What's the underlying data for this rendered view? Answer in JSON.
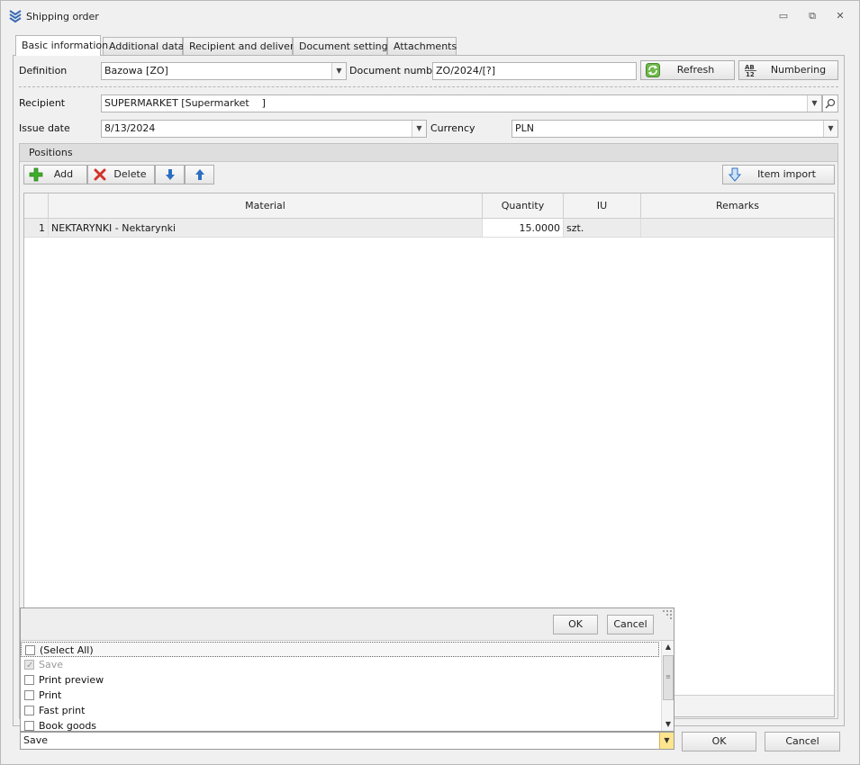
{
  "window": {
    "title": "Shipping order",
    "controls": {
      "minimize": "▭",
      "maximize": "⧉",
      "close": "✕"
    }
  },
  "tabs": [
    {
      "label": "Basic information",
      "active": true
    },
    {
      "label": "Additional data"
    },
    {
      "label": "Recipient and delivery"
    },
    {
      "label": "Document settings"
    },
    {
      "label": "Attachments"
    }
  ],
  "form": {
    "definition_label": "Definition",
    "definition_value": "Bazowa [ZO]",
    "doc_number_label": "Document number",
    "doc_number_value": "ZO/2024/[?]",
    "refresh_label": "Refresh",
    "numbering_label": "Numbering",
    "recipient_label": "Recipient",
    "recipient_value": "SUPERMARKET [Supermarket    ]",
    "issue_date_label": "Issue date",
    "issue_date_value": "8/13/2024",
    "currency_label": "Currency",
    "currency_value": "PLN"
  },
  "positions": {
    "header": "Positions",
    "add_label": "Add",
    "delete_label": "Delete",
    "item_import_label": "Item import",
    "columns": [
      "Material",
      "Quantity",
      "IU",
      "Remarks"
    ],
    "rows": [
      {
        "num": "1",
        "material": "NEKTARYNKI - Nektarynki",
        "quantity": "15.0000",
        "iu": "szt.",
        "remarks": ""
      }
    ]
  },
  "popup": {
    "ok_label": "OK",
    "cancel_label": "Cancel",
    "items": [
      {
        "label": "(Select All)",
        "checked": false,
        "disabled": false,
        "focused": true
      },
      {
        "label": "Save",
        "checked": true,
        "disabled": true
      },
      {
        "label": "Print preview",
        "checked": false
      },
      {
        "label": "Print",
        "checked": false
      },
      {
        "label": "Fast print",
        "checked": false
      },
      {
        "label": "Book goods",
        "checked": false
      }
    ]
  },
  "footer": {
    "save_combo_value": "Save",
    "ok_label": "OK",
    "cancel_label": "Cancel"
  },
  "colors": {
    "combo_accent": "#fde58f",
    "add_icon": "#3fae2a",
    "delete_icon": "#d2332a",
    "arrow_icon": "#2b6fc1"
  }
}
